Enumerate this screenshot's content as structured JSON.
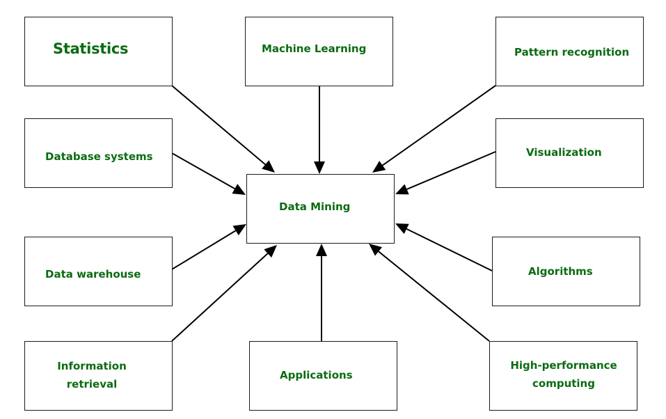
{
  "diagram": {
    "title": "Data Mining",
    "text_color": "#0b6b12",
    "line_color": "#000000",
    "center": {
      "id": "data-mining",
      "label": "Data Mining"
    },
    "sources": [
      {
        "id": "statistics",
        "label": "Statistics",
        "lines": [
          "Statistics"
        ]
      },
      {
        "id": "machine-learning",
        "label": "Machine Learning",
        "lines": [
          "Machine Learning"
        ]
      },
      {
        "id": "pattern-recognition",
        "label": "Pattern recognition",
        "lines": [
          "Pattern recognition"
        ]
      },
      {
        "id": "database-systems",
        "label": "Database systems",
        "lines": [
          "Database systems"
        ]
      },
      {
        "id": "visualization",
        "label": "Visualization",
        "lines": [
          "Visualization"
        ]
      },
      {
        "id": "data-warehouse",
        "label": "Data warehouse",
        "lines": [
          "Data warehouse"
        ]
      },
      {
        "id": "algorithms",
        "label": "Algorithms",
        "lines": [
          "Algorithms"
        ]
      },
      {
        "id": "information-retrieval",
        "label": "Information retrieval",
        "lines": [
          "Information",
          "retrieval"
        ]
      },
      {
        "id": "applications",
        "label": "Applications",
        "lines": [
          "Applications"
        ]
      },
      {
        "id": "high-performance-computing",
        "label": "High-performance computing",
        "lines": [
          "High-performance",
          "computing"
        ]
      }
    ],
    "edges": [
      {
        "from": "statistics",
        "to": "data-mining"
      },
      {
        "from": "machine-learning",
        "to": "data-mining"
      },
      {
        "from": "pattern-recognition",
        "to": "data-mining"
      },
      {
        "from": "database-systems",
        "to": "data-mining"
      },
      {
        "from": "visualization",
        "to": "data-mining"
      },
      {
        "from": "data-warehouse",
        "to": "data-mining"
      },
      {
        "from": "algorithms",
        "to": "data-mining"
      },
      {
        "from": "information-retrieval",
        "to": "data-mining"
      },
      {
        "from": "applications",
        "to": "data-mining"
      },
      {
        "from": "high-performance-computing",
        "to": "data-mining"
      }
    ]
  }
}
